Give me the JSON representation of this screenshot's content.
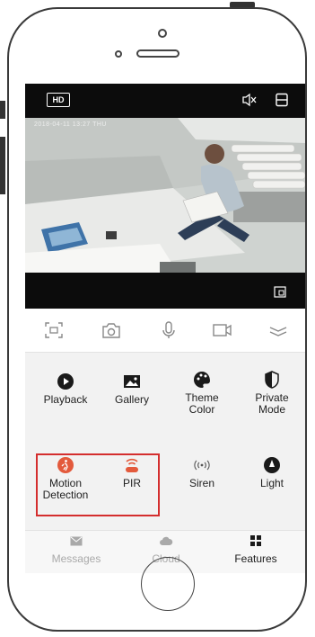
{
  "video_bar": {
    "quality_badge": "HD",
    "timestamp": "2018-04-11 13:27 THU"
  },
  "controls": [
    {
      "name": "screenshot",
      "icon": "scan-frame-icon"
    },
    {
      "name": "snapshot",
      "icon": "camera-icon"
    },
    {
      "name": "talk",
      "icon": "microphone-icon"
    },
    {
      "name": "record",
      "icon": "video-camera-icon"
    },
    {
      "name": "expand",
      "icon": "chevron-down-icon"
    }
  ],
  "features": [
    {
      "label": "Playback",
      "icon": "play-circle-icon"
    },
    {
      "label": "Gallery",
      "icon": "image-icon"
    },
    {
      "label": "Theme\nColor",
      "icon": "palette-icon"
    },
    {
      "label": "Private\nMode",
      "icon": "shield-icon"
    },
    {
      "label": "Motion\nDetection",
      "icon": "motion-person-icon"
    },
    {
      "label": "PIR",
      "icon": "pir-sensor-icon"
    },
    {
      "label": "Siren",
      "icon": "siren-waves-icon"
    },
    {
      "label": "Light",
      "icon": "compass-light-icon"
    }
  ],
  "tabs": [
    {
      "label": "Messages",
      "icon": "envelope-icon",
      "active": false
    },
    {
      "label": "Cloud",
      "icon": "cloud-icon",
      "active": false
    },
    {
      "label": "Features",
      "icon": "grid-icon",
      "active": true
    }
  ],
  "colors": {
    "highlight": "#d42e2e",
    "active_icon": "#e35a3c",
    "inactive_tab": "#a9a9a9",
    "dark": "#1a1a1a"
  }
}
